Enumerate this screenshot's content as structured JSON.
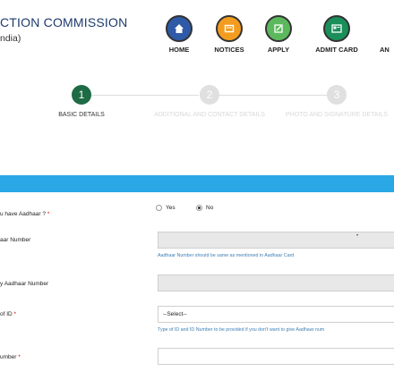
{
  "header": {
    "org_title": "CTION COMMISSION",
    "org_sub": "ndia)",
    "nav": [
      {
        "label": "HOME",
        "icon": "home-icon",
        "color": "#2e5aa7"
      },
      {
        "label": "NOTICES",
        "icon": "notices-icon",
        "color": "#f39c1f"
      },
      {
        "label": "APPLY",
        "icon": "apply-icon",
        "color": "#5cb85c"
      },
      {
        "label": "ADMIT CARD",
        "icon": "admit-card-icon",
        "color": "#1a8f5a"
      },
      {
        "label": "AN",
        "icon": "partial-icon",
        "color": "#888888"
      }
    ]
  },
  "stepper": {
    "steps": [
      {
        "number": "1",
        "label": "BASIC DETAILS",
        "active": true
      },
      {
        "number": "2",
        "label": "ADDITIONAL AND CONTACT DETAILS",
        "active": false
      },
      {
        "number": "3",
        "label": "PHOTO AND SIGNATURE DETAILS",
        "active": false
      }
    ],
    "active_color": "#1e6b45",
    "inactive_color": "#e0e0e0"
  },
  "form": {
    "aadhaar_question": "u have Aadhaar ? *",
    "aadhaar_options": {
      "yes": "Yes",
      "no": "No",
      "selected": "No"
    },
    "aadhaar_number_label": "aar Number",
    "aadhaar_number_value": "",
    "aadhaar_hint": "Aadhaar Number should be same as mentioned in Aadhaar Card",
    "enrolment_label": "y Aadhaar Number",
    "id_type_label": "of ID *",
    "id_type_value": "--Select--",
    "id_type_hint": "Type of ID and ID Number to be provided if you don't want to give Aadhaar num",
    "id_number_label": "umber *"
  },
  "colors": {
    "blue_bar": "#2aa8e6",
    "hint": "#3d7fb5",
    "title": "#1e3a6e"
  }
}
